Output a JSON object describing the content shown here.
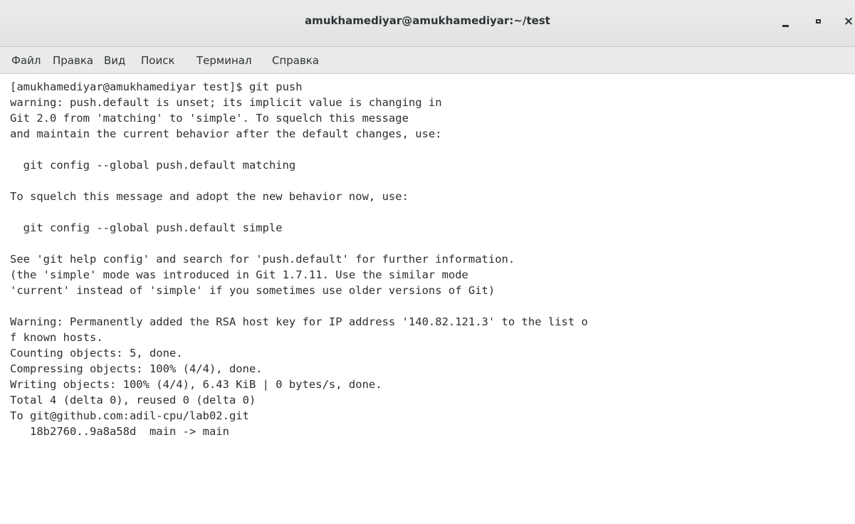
{
  "window": {
    "title": "amukhamediyar@amukhamediyar:~/test",
    "controls": {
      "minimize": "minimize",
      "maximize": "maximize",
      "close": "×"
    }
  },
  "menu": [
    "Файл",
    "Правка",
    "Вид",
    "Поиск",
    "Терминал",
    "Справка"
  ],
  "terminal": {
    "lines": [
      "[amukhamediyar@amukhamediyar test]$ git push",
      "warning: push.default is unset; its implicit value is changing in",
      "Git 2.0 from 'matching' to 'simple'. To squelch this message",
      "and maintain the current behavior after the default changes, use:",
      "",
      "  git config --global push.default matching",
      "",
      "To squelch this message and adopt the new behavior now, use:",
      "",
      "  git config --global push.default simple",
      "",
      "See 'git help config' and search for 'push.default' for further information.",
      "(the 'simple' mode was introduced in Git 1.7.11. Use the similar mode",
      "'current' instead of 'simple' if you sometimes use older versions of Git)",
      "",
      "Warning: Permanently added the RSA host key for IP address '140.82.121.3' to the list o",
      "f known hosts.",
      "Counting objects: 5, done.",
      "Compressing objects: 100% (4/4), done.",
      "Writing objects: 100% (4/4), 6.43 KiB | 0 bytes/s, done.",
      "Total 4 (delta 0), reused 0 (delta 0)",
      "To git@github.com:adil-cpu/lab02.git",
      "   18b2760..9a8a58d  main -> main"
    ]
  }
}
